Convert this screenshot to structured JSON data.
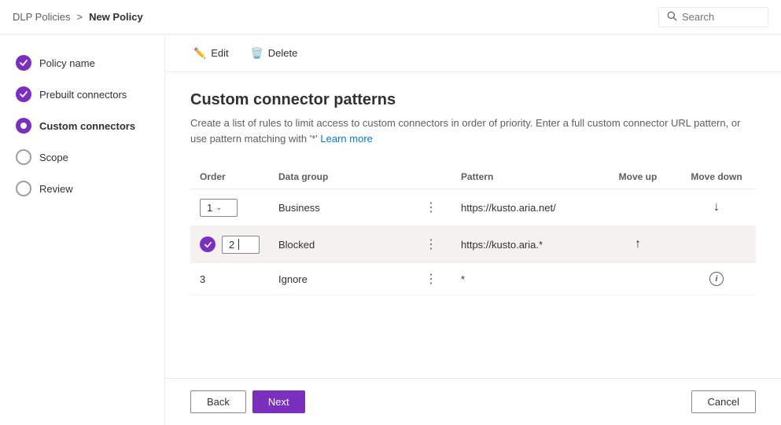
{
  "breadcrumb": {
    "parent": "DLP Policies",
    "separator": ">",
    "current": "New Policy"
  },
  "toolbar": {
    "edit_label": "Edit",
    "delete_label": "Delete",
    "search_placeholder": "Search"
  },
  "sidebar": {
    "items": [
      {
        "id": "policy-name",
        "label": "Policy name",
        "state": "completed"
      },
      {
        "id": "prebuilt-connectors",
        "label": "Prebuilt connectors",
        "state": "completed"
      },
      {
        "id": "custom-connectors",
        "label": "Custom connectors",
        "state": "active"
      },
      {
        "id": "scope",
        "label": "Scope",
        "state": "empty"
      },
      {
        "id": "review",
        "label": "Review",
        "state": "empty"
      }
    ]
  },
  "page": {
    "title": "Custom connector patterns",
    "description": "Create a list of rules to limit access to custom connectors in order of priority. Enter a full custom connector URL pattern, or use pattern matching with '*'",
    "learn_more": "Learn more"
  },
  "table": {
    "columns": {
      "order": "Order",
      "data_group": "Data group",
      "pattern": "Pattern",
      "move_up": "Move up",
      "move_down": "Move down"
    },
    "rows": [
      {
        "order": "1",
        "data_group": "Business",
        "pattern": "https://kusto.aria.net/",
        "has_dropdown": true,
        "has_check": false,
        "move_up_visible": false,
        "move_down_visible": true,
        "highlighted": false,
        "has_info": false
      },
      {
        "order": "2",
        "data_group": "Blocked",
        "pattern": "https://kusto.aria.*",
        "has_dropdown": true,
        "has_check": true,
        "move_up_visible": true,
        "move_down_visible": false,
        "highlighted": true,
        "has_info": false
      },
      {
        "order": "3",
        "data_group": "Ignore",
        "pattern": "*",
        "has_dropdown": false,
        "has_check": false,
        "move_up_visible": false,
        "move_down_visible": false,
        "highlighted": false,
        "has_info": true
      }
    ]
  },
  "footer": {
    "back_label": "Back",
    "next_label": "Next",
    "cancel_label": "Cancel"
  },
  "icons": {
    "edit": "✏",
    "delete": "🗑",
    "search": "🔍",
    "check": "✓",
    "move_down": "↓",
    "move_up": "↑",
    "dots": "⋮",
    "info": "ℹ",
    "dropdown_arrow": "⌄"
  }
}
